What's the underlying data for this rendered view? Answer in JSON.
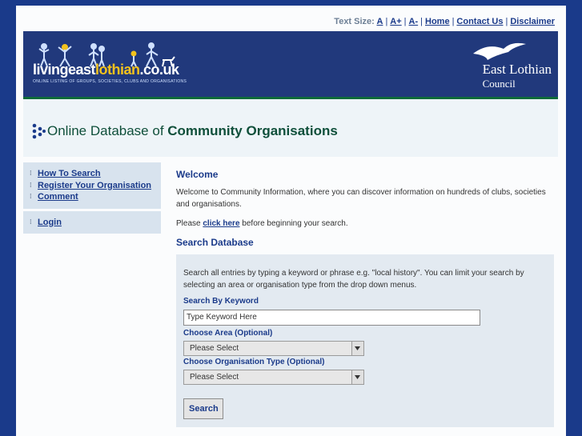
{
  "topbar": {
    "text_size_label": "Text Size:",
    "size_a": "A",
    "size_a_plus": "A+",
    "size_a_minus": "A-",
    "home": "Home",
    "contact": "Contact Us",
    "disclaimer": "Disclaimer"
  },
  "banner": {
    "logo_pre": "livingeast",
    "logo_highlight": "lothian",
    "logo_post": ".co.uk",
    "logo_tagline": "ONLINE LISTING OF GROUPS, SOCIETIES, CLUBS AND ORGANISATIONS",
    "council_line1": "East Lothian",
    "council_line2": "Council"
  },
  "title": {
    "pre": "Online Database of ",
    "bold": "Community Organisations"
  },
  "sidebar": {
    "items": [
      {
        "label": "How To Search"
      },
      {
        "label": "Register Your Organisation"
      },
      {
        "label": "Comment"
      }
    ],
    "login": "Login"
  },
  "main": {
    "welcome_heading": "Welcome",
    "welcome_text": "Welcome to Community Information, where you can discover information on hundreds of clubs, societies and organisations.",
    "please_pre": "Please ",
    "please_link": "click here",
    "please_post": " before beginning your search.",
    "search_heading": "Search Database",
    "search_intro": "Search all entries by typing a keyword or phrase e.g. \"local history\". You can limit your search by selecting an area or organisation type from the drop down menus.",
    "keyword_label": "Search By Keyword",
    "keyword_value": "Type Keyword Here",
    "area_label": "Choose Area (Optional)",
    "area_value": "Please Select",
    "type_label": "Choose Organisation Type (Optional)",
    "type_value": "Please Select",
    "search_button": "Search"
  },
  "colors": {
    "brand_blue": "#1a3a8a",
    "banner_blue": "#21397c",
    "accent_green": "#0f6b3a",
    "logo_yellow": "#f3c21d"
  }
}
